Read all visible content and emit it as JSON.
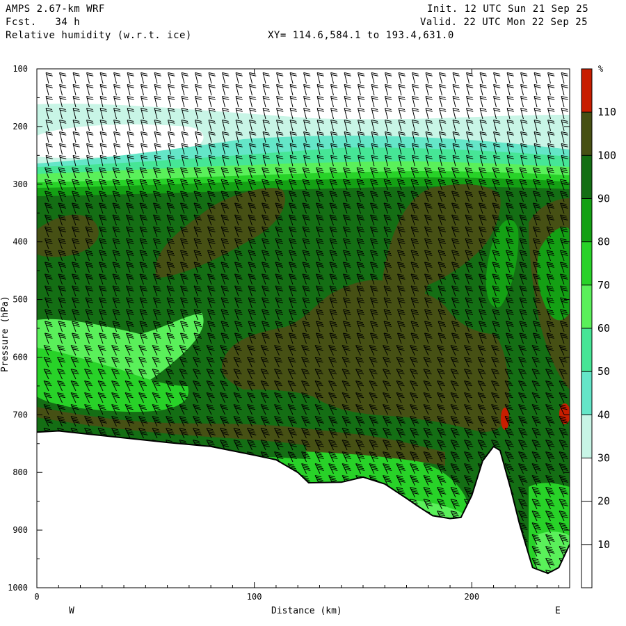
{
  "header": {
    "model": "AMPS 2.67-km WRF",
    "forecast": "Fcst.   34 h",
    "field": "Relative humidity (w.r.t. ice)",
    "xy_range": "XY= 114.6,584.1 to 193.4,631.0",
    "init": "Init. 12 UTC Sun 21 Sep 25",
    "valid": "Valid. 22 UTC Mon 22 Sep 25"
  },
  "chart_data": {
    "type": "heatmap",
    "title": "Relative humidity (w.r.t. ice)",
    "xlabel": "Distance (km)",
    "ylabel": "Pressure (hPa)",
    "xlim": [
      0,
      245
    ],
    "ylim": [
      1000,
      100
    ],
    "x_ticks": [
      0,
      100,
      200
    ],
    "y_ticks": [
      100,
      200,
      300,
      400,
      500,
      600,
      700,
      800,
      900,
      1000
    ],
    "direction_labels": {
      "left": "W",
      "right": "E"
    },
    "colorbar": {
      "unit": "%",
      "levels": [
        10,
        20,
        30,
        40,
        50,
        60,
        70,
        80,
        90,
        100,
        110
      ],
      "colors": [
        "#ffffff",
        "#ffffff",
        "#ffffff",
        "#c8f5e6",
        "#64e6c8",
        "#46e696",
        "#5af05a",
        "#28d228",
        "#14a014",
        "#146e14",
        "#465014",
        "#c81e00"
      ]
    },
    "terrain_profile": {
      "distance_km": [
        0,
        10,
        20,
        40,
        60,
        80,
        100,
        110,
        120,
        125,
        140,
        150,
        160,
        170,
        175,
        182,
        190,
        195,
        200,
        205,
        210,
        213,
        218,
        222,
        228,
        235,
        240,
        245
      ],
      "pressure_hpa": [
        730,
        728,
        732,
        740,
        748,
        755,
        770,
        778,
        800,
        818,
        817,
        808,
        820,
        845,
        858,
        875,
        880,
        878,
        840,
        780,
        755,
        762,
        830,
        890,
        965,
        975,
        965,
        925
      ]
    },
    "rh_samples": [
      {
        "distance_km": 20,
        "pressure_hpa": 400,
        "rh_pct": 105
      },
      {
        "distance_km": 80,
        "pressure_hpa": 350,
        "rh_pct": 105
      },
      {
        "distance_km": 180,
        "pressure_hpa": 380,
        "rh_pct": 105
      },
      {
        "distance_km": 140,
        "pressure_hpa": 550,
        "rh_pct": 105
      },
      {
        "distance_km": 200,
        "pressure_hpa": 600,
        "rh_pct": 105
      },
      {
        "distance_km": 20,
        "pressure_hpa": 560,
        "rh_pct": 75
      },
      {
        "distance_km": 40,
        "pressure_hpa": 220,
        "rh_pct": 15
      },
      {
        "distance_km": 150,
        "pressure_hpa": 150,
        "rh_pct": 10
      },
      {
        "distance_km": 213,
        "pressure_hpa": 710,
        "rh_pct": 115
      },
      {
        "distance_km": 243,
        "pressure_hpa": 700,
        "rh_pct": 115
      }
    ]
  }
}
